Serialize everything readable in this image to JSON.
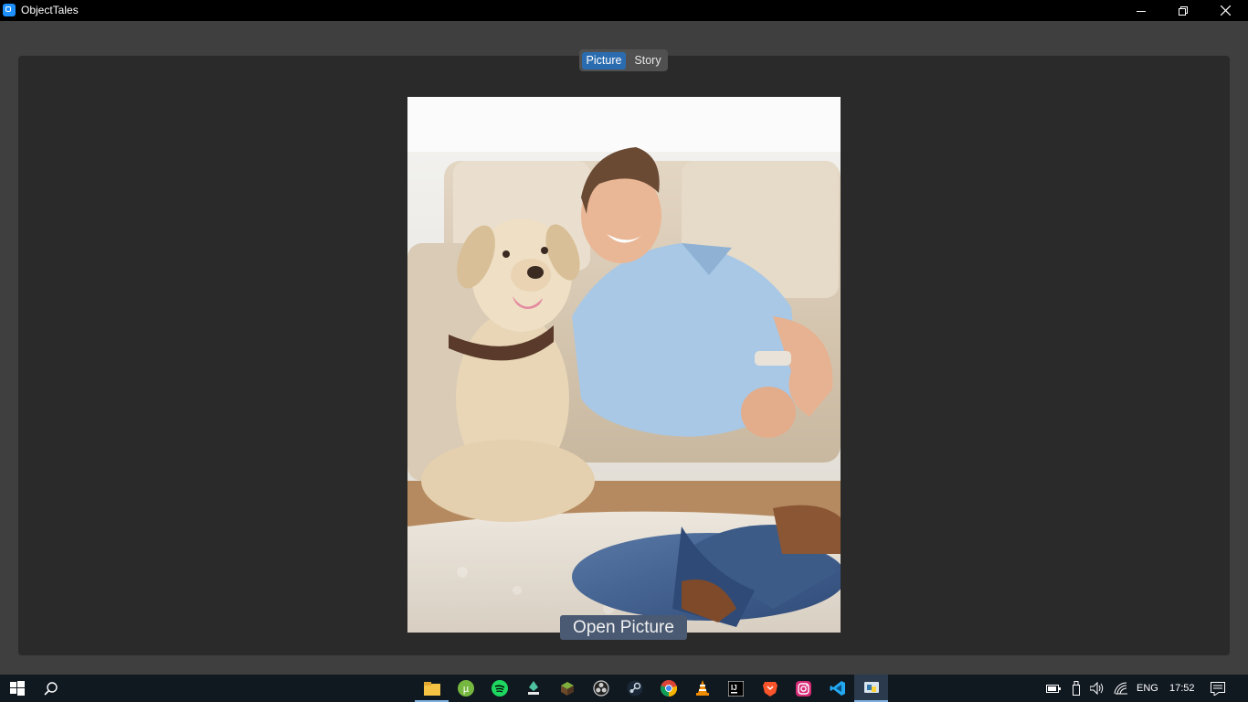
{
  "window": {
    "title": "ObjectTales",
    "minimize_icon": "minimize-icon",
    "restore_icon": "restore-icon",
    "close_icon": "close-icon"
  },
  "tabs": [
    {
      "label": "Picture",
      "active": true
    },
    {
      "label": "Story",
      "active": false
    }
  ],
  "photo": {
    "subject": "photo-man-with-labrador-dog"
  },
  "open_picture_button": {
    "label": "Open Picture"
  },
  "taskbar": {
    "start_icon": "windows-start-icon",
    "search_icon": "search-icon",
    "apps": [
      {
        "name": "file-explorer-icon",
        "color": "#f6c344"
      },
      {
        "name": "utorrent-icon",
        "color": "#76b83f"
      },
      {
        "name": "spotify-icon",
        "color": "#1ed760"
      },
      {
        "name": "app-icon",
        "color": "#4fc3a0"
      },
      {
        "name": "minecraft-icon",
        "color": "#6b8f3a"
      },
      {
        "name": "obs-icon",
        "color": "#cccccc"
      },
      {
        "name": "steam-icon",
        "color": "#c7d5e0"
      },
      {
        "name": "chrome-icon",
        "color": "#4285f4"
      },
      {
        "name": "vlc-icon",
        "color": "#f08c00"
      },
      {
        "name": "intellij-icon",
        "color": "#ffffff"
      },
      {
        "name": "brave-icon",
        "color": "#fb542b"
      },
      {
        "name": "instagram-icon",
        "color": "#d62976"
      },
      {
        "name": "vscode-icon",
        "color": "#23a9f2"
      },
      {
        "name": "python-icon",
        "color": "#3776ab"
      }
    ],
    "tray": {
      "language": "ENG",
      "time": "17:52",
      "notification_icon": "notification-icon"
    }
  }
}
